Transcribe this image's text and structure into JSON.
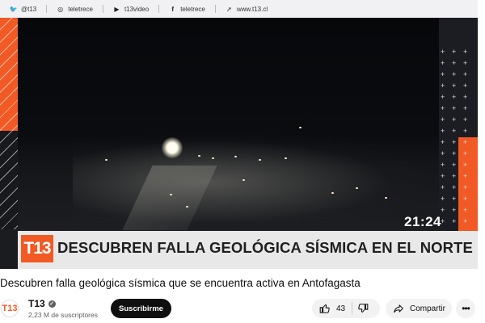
{
  "social_bar": {
    "twitter_icon": "twitter-icon",
    "twitter_handle": "@t13",
    "instagram_icon": "instagram-icon",
    "instagram_handle": "teletrece",
    "youtube_icon": "youtube-icon",
    "youtube_handle": "t13video",
    "facebook_icon": "facebook-icon",
    "facebook_handle": "teletrece",
    "web_icon": "web-icon",
    "website": "www.t13.cl"
  },
  "video": {
    "timestamp": "21:24",
    "logo_text": "T13",
    "headline": "DESCUBREN FALLA GEOLÓGICA SÍSMICA EN EL NORTE"
  },
  "video_title": "Descubren falla geológica sísmica que se encuentra activa en Antofagasta",
  "channel": {
    "avatar_text": "T13",
    "name": "T13",
    "subscribers": "2,23 M de suscriptores",
    "subscribe_label": "Suscribirme"
  },
  "actions": {
    "like_count": "43",
    "share_label": "Compartir",
    "more_label": "•••"
  },
  "colors": {
    "brand_orange": "#f15a24",
    "subscribe_bg": "#0f0f0f",
    "pill_bg": "#f2f2f2"
  }
}
